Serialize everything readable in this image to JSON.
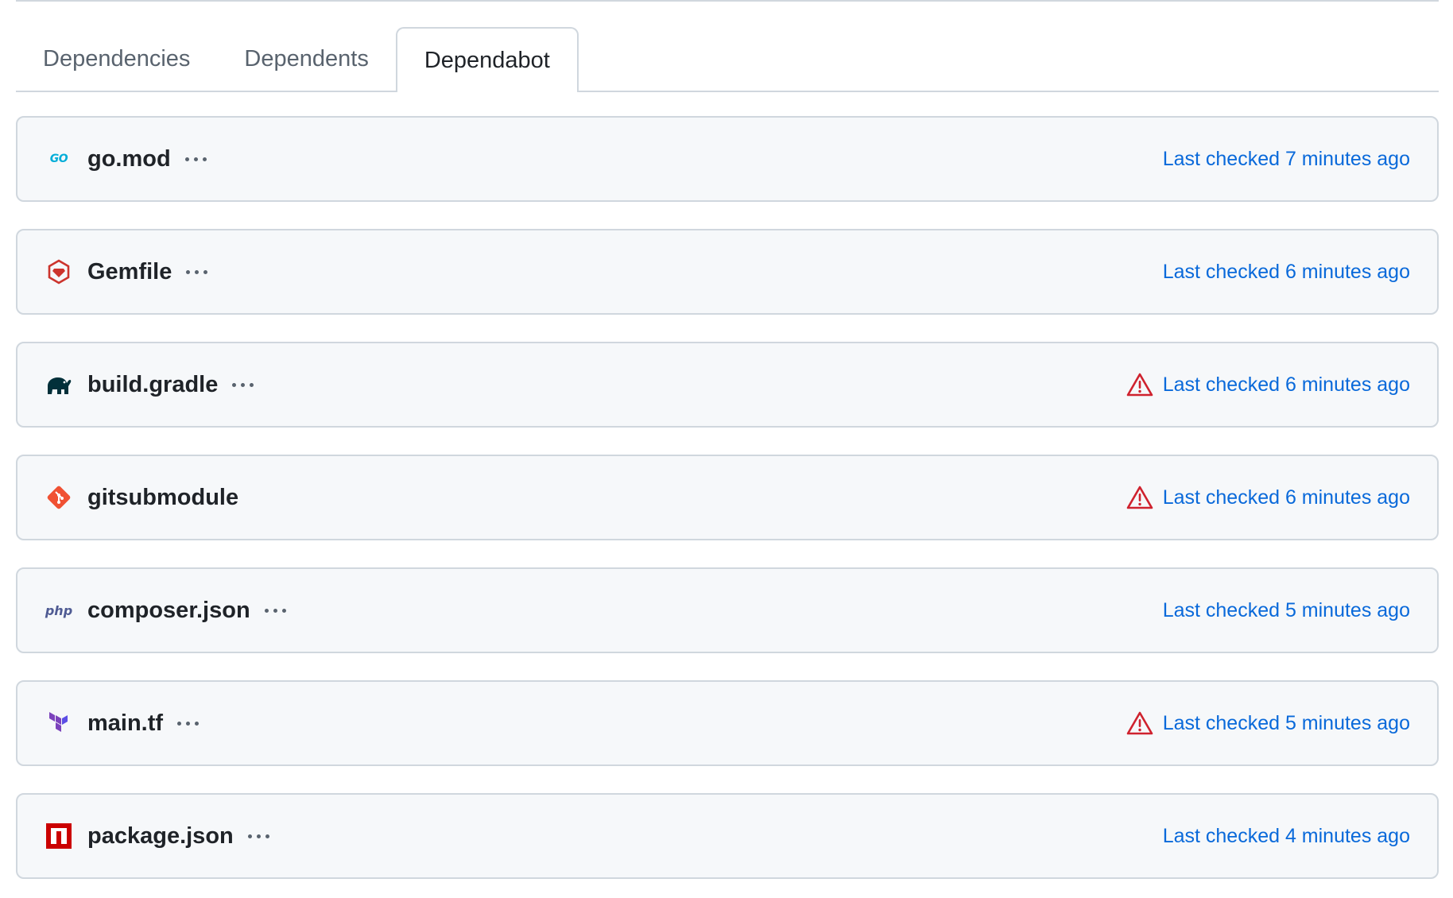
{
  "tabs": [
    {
      "label": "Dependencies",
      "active": false
    },
    {
      "label": "Dependents",
      "active": false
    },
    {
      "label": "Dependabot",
      "active": true
    }
  ],
  "colors": {
    "link": "#0969da",
    "warning": "#cf222e",
    "row_background": "#f6f8fa",
    "border": "#d0d7de"
  },
  "manifests": [
    {
      "name": "go.mod",
      "icon": "go-icon",
      "icon_text": "GO",
      "has_menu": true,
      "has_warning": false,
      "last_checked": "Last checked 7 minutes ago"
    },
    {
      "name": "Gemfile",
      "icon": "ruby-gem-icon",
      "has_menu": true,
      "has_warning": false,
      "last_checked": "Last checked 6 minutes ago"
    },
    {
      "name": "build.gradle",
      "icon": "gradle-elephant-icon",
      "has_menu": true,
      "has_warning": true,
      "last_checked": "Last checked 6 minutes ago"
    },
    {
      "name": "gitsubmodule",
      "icon": "git-icon",
      "has_menu": false,
      "has_warning": true,
      "last_checked": "Last checked 6 minutes ago"
    },
    {
      "name": "composer.json",
      "icon": "php-icon",
      "icon_text": "php",
      "has_menu": true,
      "has_warning": false,
      "last_checked": "Last checked 5 minutes ago"
    },
    {
      "name": "main.tf",
      "icon": "terraform-icon",
      "has_menu": true,
      "has_warning": true,
      "last_checked": "Last checked 5 minutes ago"
    },
    {
      "name": "package.json",
      "icon": "npm-icon",
      "has_menu": true,
      "has_warning": false,
      "last_checked": "Last checked 4 minutes ago"
    }
  ]
}
